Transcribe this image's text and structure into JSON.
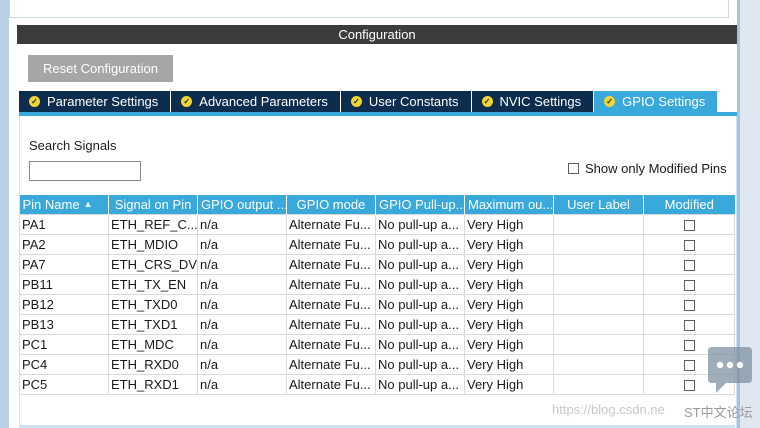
{
  "configuration": {
    "header": "Configuration",
    "reset_button": "Reset Configuration"
  },
  "tabs": [
    {
      "label": "Parameter Settings",
      "active": false
    },
    {
      "label": "Advanced Parameters",
      "active": false
    },
    {
      "label": "User Constants",
      "active": false
    },
    {
      "label": "NVIC Settings",
      "active": false
    },
    {
      "label": "GPIO Settings",
      "active": true
    }
  ],
  "search": {
    "label": "Search Signals",
    "value": ""
  },
  "modified_filter": {
    "label": "Show only Modified Pins",
    "checked": false
  },
  "table": {
    "columns": [
      "Pin Name",
      "Signal on Pin",
      "GPIO output ...",
      "GPIO mode",
      "GPIO Pull-up...",
      "Maximum ou...",
      "User Label",
      "Modified"
    ],
    "rows": [
      {
        "pin": "PA1",
        "signal": "ETH_REF_C...",
        "output": "n/a",
        "mode": "Alternate Fu...",
        "pull": "No pull-up a...",
        "speed": "Very High",
        "label": "",
        "modified": false
      },
      {
        "pin": "PA2",
        "signal": "ETH_MDIO",
        "output": "n/a",
        "mode": "Alternate Fu...",
        "pull": "No pull-up a...",
        "speed": "Very High",
        "label": "",
        "modified": false
      },
      {
        "pin": "PA7",
        "signal": "ETH_CRS_DV",
        "output": "n/a",
        "mode": "Alternate Fu...",
        "pull": "No pull-up a...",
        "speed": "Very High",
        "label": "",
        "modified": false
      },
      {
        "pin": "PB11",
        "signal": "ETH_TX_EN",
        "output": "n/a",
        "mode": "Alternate Fu...",
        "pull": "No pull-up a...",
        "speed": "Very High",
        "label": "",
        "modified": false
      },
      {
        "pin": "PB12",
        "signal": "ETH_TXD0",
        "output": "n/a",
        "mode": "Alternate Fu...",
        "pull": "No pull-up a...",
        "speed": "Very High",
        "label": "",
        "modified": false
      },
      {
        "pin": "PB13",
        "signal": "ETH_TXD1",
        "output": "n/a",
        "mode": "Alternate Fu...",
        "pull": "No pull-up a...",
        "speed": "Very High",
        "label": "",
        "modified": false
      },
      {
        "pin": "PC1",
        "signal": "ETH_MDC",
        "output": "n/a",
        "mode": "Alternate Fu...",
        "pull": "No pull-up a...",
        "speed": "Very High",
        "label": "",
        "modified": false
      },
      {
        "pin": "PC4",
        "signal": "ETH_RXD0",
        "output": "n/a",
        "mode": "Alternate Fu...",
        "pull": "No pull-up a...",
        "speed": "Very High",
        "label": "",
        "modified": false
      },
      {
        "pin": "PC5",
        "signal": "ETH_RXD1",
        "output": "n/a",
        "mode": "Alternate Fu...",
        "pull": "No pull-up a...",
        "speed": "Very High",
        "label": "",
        "modified": false
      }
    ]
  },
  "watermark": {
    "url": "https://blog.csdn.ne",
    "brand": "ST中文论坛"
  },
  "colors": {
    "tab_bg": "#0d2d4f",
    "tab_active": "#39a9dc",
    "header_bg": "#3c3c3c",
    "reset_bg": "#a6a6a6",
    "check_badge": "#f2d531"
  },
  "icons": {
    "tab_check": "check-circle-icon",
    "sort": "sort-ascending-icon",
    "watermark": "chat-bubble-icon"
  }
}
